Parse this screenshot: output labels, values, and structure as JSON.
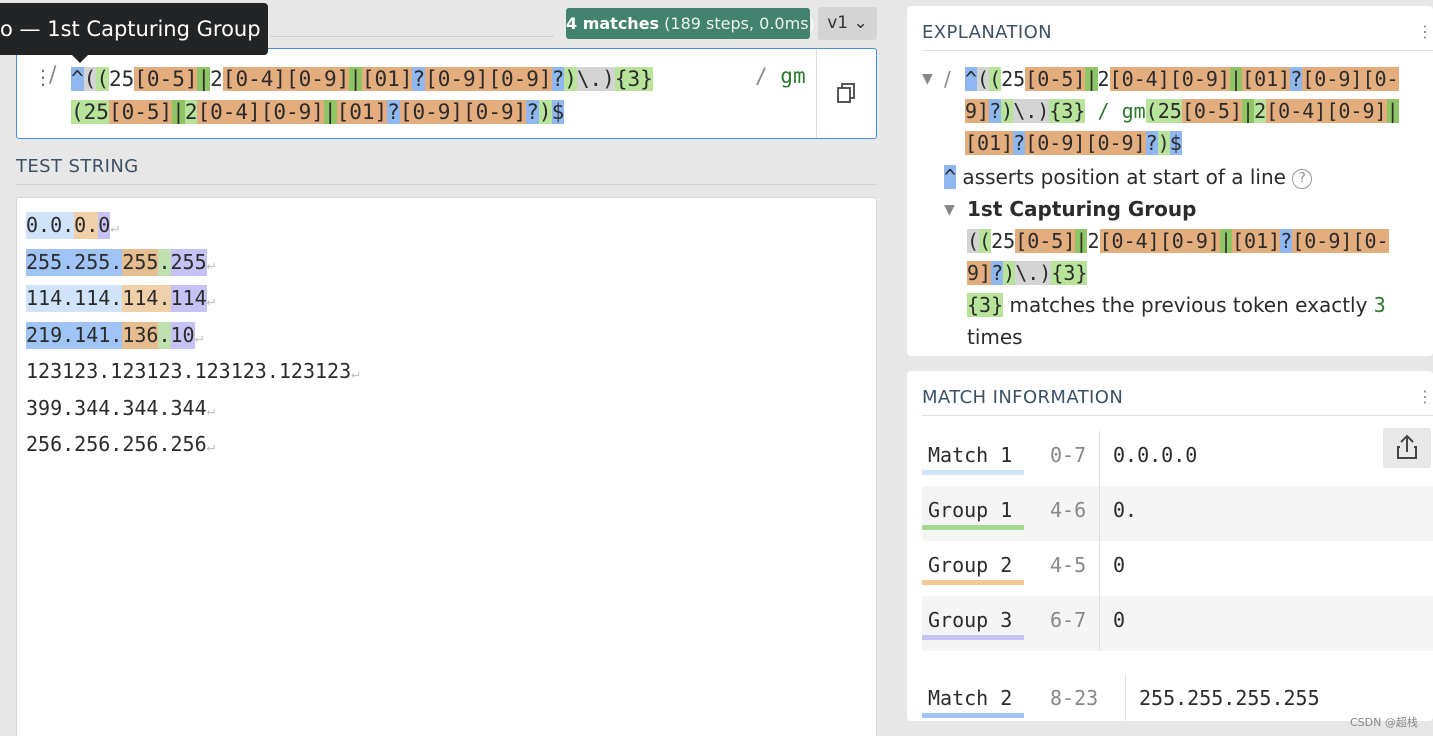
{
  "tooltip": "— 1st Capturing Group",
  "tooltip_prefix": "o",
  "badge": {
    "matches": "4 matches",
    "steps": "(189 steps, 0.0ms)"
  },
  "version": "v1",
  "regex": {
    "flags": "gm",
    "line1_tokens": [
      {
        "t": "^",
        "c": "t-blue"
      },
      {
        "t": "(",
        "c": "t-gray"
      },
      {
        "t": "(",
        "c": "t-green"
      },
      {
        "t": "25",
        "c": "t-sel"
      },
      {
        "t": "[0-5]",
        "c": "t-orange"
      },
      {
        "t": "|",
        "c": "t-green-dark"
      },
      {
        "t": "2",
        "c": "t-sel"
      },
      {
        "t": "[0-4]",
        "c": "t-orange"
      },
      {
        "t": "[0-9]",
        "c": "t-orange"
      },
      {
        "t": "|",
        "c": "t-green-dark"
      },
      {
        "t": "[01]",
        "c": "t-orange"
      },
      {
        "t": "?",
        "c": "t-blue"
      },
      {
        "t": "[0-9]",
        "c": "t-orange"
      },
      {
        "t": "[0-9]",
        "c": "t-orange"
      },
      {
        "t": "?",
        "c": "t-blue"
      },
      {
        "t": ")",
        "c": "t-green"
      },
      {
        "t": "\\.",
        "c": "t-gray"
      },
      {
        "t": ")",
        "c": "t-gray"
      },
      {
        "t": "{3}",
        "c": "t-green"
      }
    ],
    "line2_tokens": [
      {
        "t": "(",
        "c": "t-green"
      },
      {
        "t": "25",
        "c": "t-green"
      },
      {
        "t": "[0-5]",
        "c": "t-orange"
      },
      {
        "t": "|",
        "c": "t-green-dark"
      },
      {
        "t": "2",
        "c": "t-green"
      },
      {
        "t": "[0-4]",
        "c": "t-orange"
      },
      {
        "t": "[0-9]",
        "c": "t-orange"
      },
      {
        "t": "|",
        "c": "t-green-dark"
      },
      {
        "t": "[01]",
        "c": "t-orange"
      },
      {
        "t": "?",
        "c": "t-blue"
      },
      {
        "t": "[0-9]",
        "c": "t-orange"
      },
      {
        "t": "[0-9]",
        "c": "t-orange"
      },
      {
        "t": "?",
        "c": "t-blue"
      },
      {
        "t": ")",
        "c": "t-green"
      },
      {
        "t": "$",
        "c": "t-blue"
      }
    ]
  },
  "test_string": {
    "label": "TEST STRING",
    "lines": [
      [
        {
          "t": "0.0.",
          "c": "h-light"
        },
        {
          "t": "0.",
          "c": "h-orange"
        },
        {
          "t": "0",
          "c": "h-purple"
        }
      ],
      [
        {
          "t": "255.255.",
          "c": "h-blue"
        },
        {
          "t": "255",
          "c": "h-orange2"
        },
        {
          "t": ".",
          "c": "h-green"
        },
        {
          "t": "255",
          "c": "h-purple"
        }
      ],
      [
        {
          "t": "114.114.",
          "c": "h-light"
        },
        {
          "t": "114",
          "c": "h-orange"
        },
        {
          "t": ".",
          "c": "h-orange"
        },
        {
          "t": "114",
          "c": "h-purple"
        }
      ],
      [
        {
          "t": "219.141.",
          "c": "h-blue"
        },
        {
          "t": "136",
          "c": "h-orange2"
        },
        {
          "t": ".",
          "c": "h-green"
        },
        {
          "t": "10",
          "c": "h-purple"
        }
      ],
      [
        {
          "t": "123123.123123.123123.123123",
          "c": ""
        }
      ],
      [
        {
          "t": "399.344.344.344",
          "c": ""
        }
      ],
      [
        {
          "t": "256.256.256.256",
          "c": ""
        }
      ]
    ],
    "return_glyph": "↵"
  },
  "explanation": {
    "title": "EXPLANATION",
    "anchor_desc": "asserts position at start of a line",
    "group_title": "1st Capturing Group",
    "quant_desc": "matches the previous token exactly",
    "quant_count": "3",
    "quant_tail": "times",
    "help": "?"
  },
  "match_info": {
    "title": "MATCH INFORMATION",
    "rows": [
      {
        "name": "Match 1",
        "range": "0-7",
        "value": "0.0.0.0",
        "bar": "#cfe4fb"
      },
      {
        "name": "Group 1",
        "range": "4-6",
        "value": "0.",
        "bar": "#a6d98f"
      },
      {
        "name": "Group 2",
        "range": "4-5",
        "value": "0",
        "bar": "#f0c890"
      },
      {
        "name": "Group 3",
        "range": "6-7",
        "value": "0",
        "bar": "#c7c2f5"
      },
      {
        "name": "Match 2",
        "range": "8-23",
        "value": "255.255.255.255",
        "bar": "#9fc4f5"
      }
    ]
  },
  "watermark": "CSDN @超栈"
}
